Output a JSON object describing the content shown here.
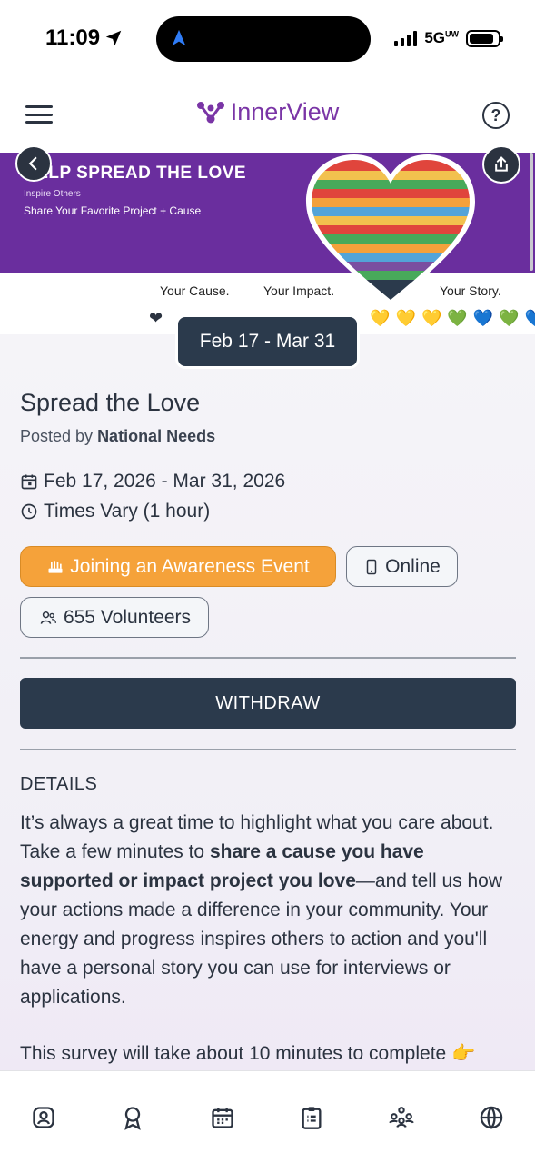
{
  "status_bar": {
    "time": "11:09",
    "network": "5G",
    "network_sup": "UW",
    "battery_level": 0.85
  },
  "header": {
    "brand": "InnerView"
  },
  "banner": {
    "headline": "HELP SPREAD THE LOVE",
    "sub1": "Inspire Others",
    "sub2": "Share Your Favorite Project + Cause",
    "tagline_cause": "Your Cause.",
    "tagline_impact": "Your Impact.",
    "tagline_story": "Your Story.",
    "hearts": [
      "❤",
      "💛",
      "💛",
      "💛",
      "💚",
      "💙",
      "💚",
      "💙",
      "💙"
    ]
  },
  "event": {
    "date_chip": "Feb 17 - Mar 31",
    "title": "Spread the Love",
    "posted_prefix": "Posted by ",
    "posted_by": "National Needs",
    "dates": "Feb 17, 2026 - Mar 31, 2026",
    "times": "Times Vary (1 hour)",
    "category": "Joining an Awareness Event",
    "mode": "Online",
    "volunteers": "655 Volunteers",
    "action": "WITHDRAW"
  },
  "details": {
    "heading": "DETAILS",
    "p_part1": "It’s always a great time to highlight what you care about. Take a few minutes to ",
    "p_bold": "share a cause you have supported or impact project you love",
    "p_part2": "—and tell us how your actions made a difference in your community. Your energy and progress inspires others to action and you'll have a personal story you can use for interviews or applications.",
    "survey": "This survey will take about 10 minutes to complete 👉"
  },
  "nav": [
    "profile-icon",
    "award-icon",
    "calendar-icon",
    "clipboard-icon",
    "community-icon",
    "globe-icon"
  ],
  "colors": {
    "brand": "#7a35a6",
    "dark": "#2b3a4c",
    "orange": "#f5a23a",
    "banner": "#6a2e9e"
  }
}
